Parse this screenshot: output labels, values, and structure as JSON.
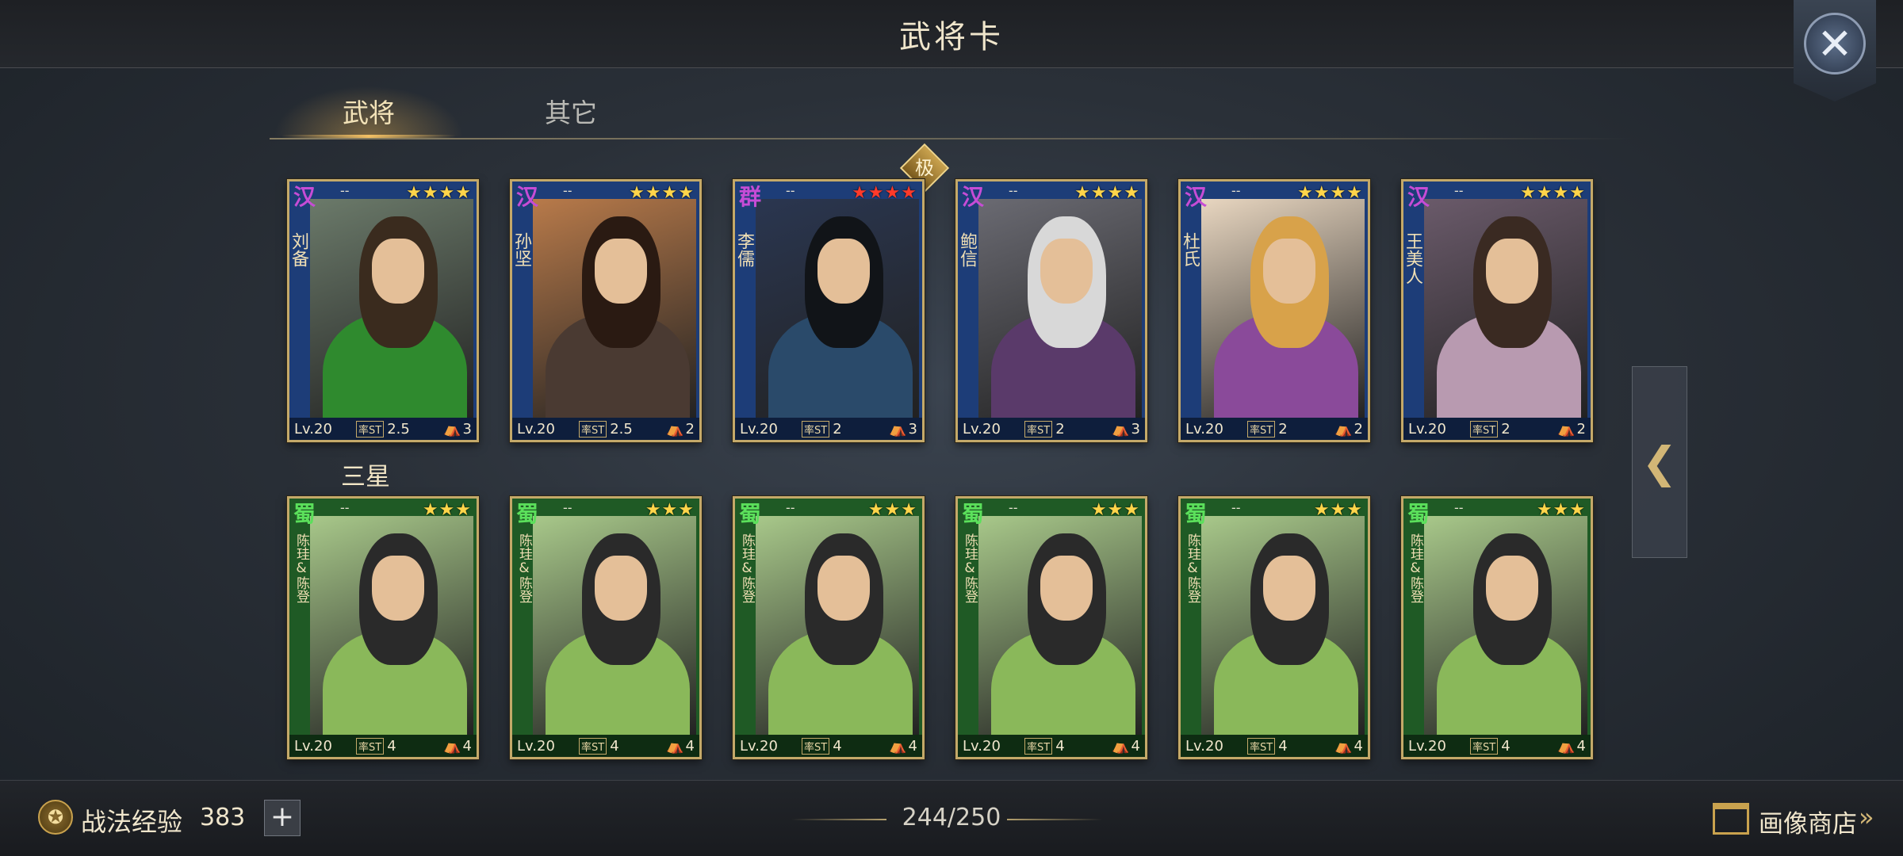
{
  "header": {
    "title": "武将卡"
  },
  "tabs": {
    "active": "武将",
    "other": "其它"
  },
  "section": {
    "label": "三星"
  },
  "top_marker": "极",
  "cards": [
    {
      "faction": "汉",
      "dash": "--",
      "stars": "★★★★",
      "name": "刘备",
      "level": "Lv.20",
      "cost": "2.5",
      "count": "3",
      "color": "blue",
      "theme": {
        "bg": "#6b7a6a",
        "hair": "#3a2b1e",
        "body": "#2f8a2e"
      }
    },
    {
      "faction": "汉",
      "dash": "--",
      "stars": "★★★★",
      "name": "孙坚",
      "level": "Lv.20",
      "cost": "2.5",
      "count": "2",
      "color": "blue",
      "theme": {
        "bg": "#b87a4a",
        "hair": "#2a1a12",
        "body": "#4a3a32"
      }
    },
    {
      "faction": "群",
      "dash": "--",
      "stars": "★★★★",
      "name": "李儒",
      "level": "Lv.20",
      "cost": "2",
      "count": "3",
      "color": "blue",
      "red_stars": true,
      "theme": {
        "bg": "#2a3650",
        "hair": "#111418",
        "body": "#2a4a6a"
      }
    },
    {
      "faction": "汉",
      "dash": "--",
      "stars": "★★★★",
      "name": "鲍信",
      "level": "Lv.20",
      "cost": "2",
      "count": "3",
      "color": "blue",
      "theme": {
        "bg": "#6a6a72",
        "hair": "#d8d8d8",
        "body": "#5a3a6a"
      }
    },
    {
      "faction": "汉",
      "dash": "--",
      "stars": "★★★★",
      "name": "杜氏",
      "level": "Lv.20",
      "cost": "2",
      "count": "2",
      "color": "blue",
      "theme": {
        "bg": "#e8d6c0",
        "hair": "#d8a24a",
        "body": "#8a4a9a"
      }
    },
    {
      "faction": "汉",
      "dash": "--",
      "stars": "★★★★",
      "name": "王美人",
      "level": "Lv.20",
      "cost": "2",
      "count": "2",
      "color": "blue",
      "theme": {
        "bg": "#6a5a6a",
        "hair": "#3a2a22",
        "body": "#b89ab0"
      }
    },
    {
      "faction": "蜀",
      "dash": "--",
      "stars": "★★★",
      "name": "陈珪&陈登",
      "level": "Lv.20",
      "cost": "4",
      "count": "4",
      "color": "green",
      "theme": {
        "bg": "#a8c88a",
        "hair": "#2a2a2a",
        "body": "#8ab85a"
      }
    },
    {
      "faction": "蜀",
      "dash": "--",
      "stars": "★★★",
      "name": "陈珪&陈登",
      "level": "Lv.20",
      "cost": "4",
      "count": "4",
      "color": "green",
      "theme": {
        "bg": "#a8c88a",
        "hair": "#2a2a2a",
        "body": "#8ab85a"
      }
    },
    {
      "faction": "蜀",
      "dash": "--",
      "stars": "★★★",
      "name": "陈珪&陈登",
      "level": "Lv.20",
      "cost": "4",
      "count": "4",
      "color": "green",
      "theme": {
        "bg": "#a8c88a",
        "hair": "#2a2a2a",
        "body": "#8ab85a"
      }
    },
    {
      "faction": "蜀",
      "dash": "--",
      "stars": "★★★",
      "name": "陈珪&陈登",
      "level": "Lv.20",
      "cost": "4",
      "count": "4",
      "color": "green",
      "theme": {
        "bg": "#a8c88a",
        "hair": "#2a2a2a",
        "body": "#8ab85a"
      }
    },
    {
      "faction": "蜀",
      "dash": "--",
      "stars": "★★★",
      "name": "陈珪&陈登",
      "level": "Lv.20",
      "cost": "4",
      "count": "4",
      "color": "green",
      "theme": {
        "bg": "#a8c88a",
        "hair": "#2a2a2a",
        "body": "#8ab85a"
      }
    },
    {
      "faction": "蜀",
      "dash": "--",
      "stars": "★★★",
      "name": "陈珪&陈登",
      "level": "Lv.20",
      "cost": "4",
      "count": "4",
      "color": "green",
      "theme": {
        "bg": "#a8c88a",
        "hair": "#2a2a2a",
        "body": "#8ab85a"
      }
    }
  ],
  "card_stat_tag": "率ST",
  "footer": {
    "exp_label": "战法经验",
    "exp_value": "383",
    "plus_label": "+",
    "capacity": "244/250",
    "shop_label": "画像商店",
    "shop_arrow": "»"
  },
  "icons": {
    "close": "crossed-swords-icon",
    "side_arrow": "chevron-left-icon",
    "exp": "exp-emblem-icon",
    "shop": "shop-icon"
  }
}
